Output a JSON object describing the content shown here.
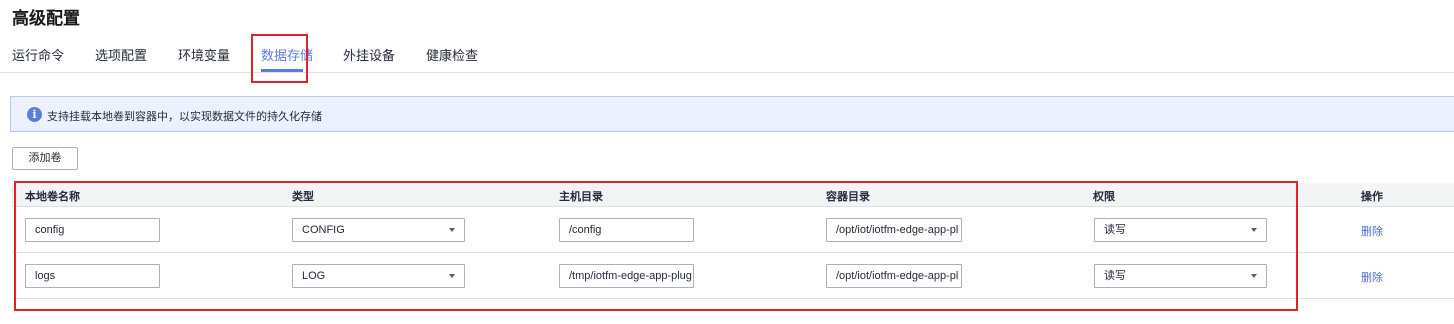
{
  "section_title": "高级配置",
  "tabs": [
    {
      "label": "运行命令"
    },
    {
      "label": "选项配置"
    },
    {
      "label": "环境变量"
    },
    {
      "label": "数据存储",
      "active": true
    },
    {
      "label": "外挂设备"
    },
    {
      "label": "健康检查"
    }
  ],
  "info": {
    "icon": "info-icon",
    "text": "支持挂载本地卷到容器中，以实现数据文件的持久化存储"
  },
  "add_button_label": "添加卷",
  "table": {
    "headers": [
      "本地卷名称",
      "类型",
      "主机目录",
      "容器目录",
      "权限",
      "操作"
    ],
    "rows": [
      {
        "name": "config",
        "type": "CONFIG",
        "host_dir": "/config",
        "container_dir": "/opt/iot/iotfm-edge-app-pl",
        "permission": "读写",
        "action": "删除"
      },
      {
        "name": "logs",
        "type": "LOG",
        "host_dir": "/tmp/iotfm-edge-app-plug",
        "container_dir": "/opt/iot/iotfm-edge-app-pl",
        "permission": "读写",
        "action": "删除"
      }
    ]
  },
  "colors": {
    "accent": "#5e7ce0",
    "highlight_box": "#e0212e",
    "link": "#526ecc"
  }
}
